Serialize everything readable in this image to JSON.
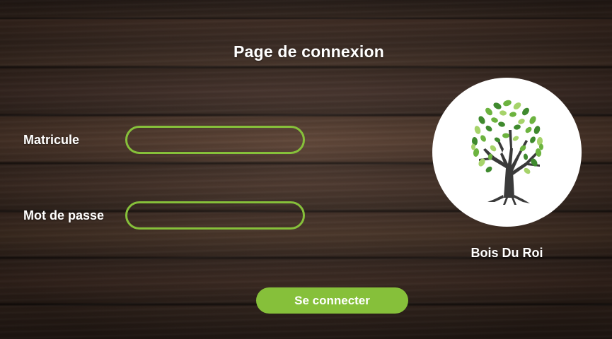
{
  "page": {
    "title": "Page de connexion"
  },
  "form": {
    "matricule_label": "Matricule",
    "matricule_value": "",
    "password_label": "Mot de passe",
    "password_value": "",
    "submit_label": "Se connecter"
  },
  "brand": {
    "name": "Bois Du Roi",
    "logo_icon": "tree-icon"
  },
  "colors": {
    "accent": "#86c03a",
    "text": "#ffffff",
    "logo_background": "#ffffff",
    "tree_trunk": "#3a3a3a",
    "leaf_dark": "#3f8a2e",
    "leaf_mid": "#6cb33f",
    "leaf_light": "#a6d36a"
  }
}
